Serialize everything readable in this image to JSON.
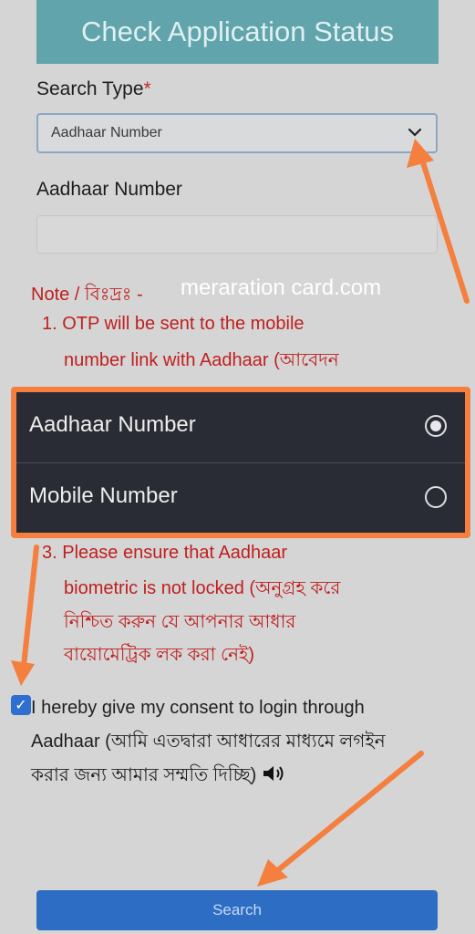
{
  "header": {
    "title": "Check Application Status"
  },
  "search_type": {
    "label": "Search Type",
    "required_mark": "*",
    "selected": "Aadhaar Number"
  },
  "aadhaar_field": {
    "label": "Aadhaar Number",
    "value": ""
  },
  "note": {
    "title": "Note / বিঃদ্রঃ -",
    "item1_line1": "1. OTP will be sent to the mobile",
    "item1_line2": "number link with Aadhaar (আবেদন",
    "item3_line1": "3. Please ensure that Aadhaar",
    "item3_line2": "biometric is not locked (অনুগ্রহ করে",
    "item3_line3": "নিশ্চিত করুন যে আপনার আধার",
    "item3_line4": "বায়োমেট্রিক লক করা নেই)"
  },
  "watermark": "meraration card.com",
  "dropdown": {
    "options": [
      {
        "label": "Aadhaar Number",
        "selected": true
      },
      {
        "label": "Mobile Number",
        "selected": false
      }
    ]
  },
  "consent": {
    "text": "I hereby give my consent to login through Aadhaar (আমি এতদ্বারা আধারের মাধ্যমে লগইন করার জন্য আমার সম্মতি দিচ্ছি)",
    "audio_icon": "speaker-icon",
    "checked": true
  },
  "search_button": {
    "label": "Search"
  },
  "colors": {
    "annotation": "#f47f3e",
    "primary": "#2d6dc4",
    "header": "#62a4ab",
    "note_red": "#c01f1f"
  }
}
